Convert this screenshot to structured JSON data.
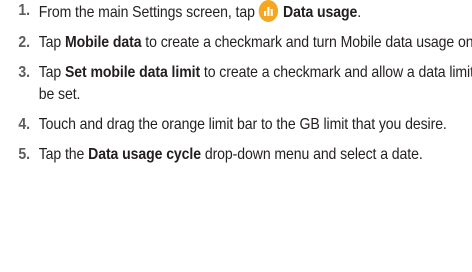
{
  "steps": [
    {
      "number": "1.",
      "pre": "From the main Settings screen, tap",
      "bold": "Data usage",
      "post": ".",
      "icon": "data-usage-icon",
      "icon_color": "#f5a623"
    },
    {
      "number": "2.",
      "pre": "Tap ",
      "bold": "Mobile data",
      "post": " to create a checkmark and turn Mobile data usage on."
    },
    {
      "number": "3.",
      "pre": "Tap ",
      "bold": "Set mobile data limit",
      "post": " to create a checkmark and allow a data limit to be set."
    },
    {
      "number": "4.",
      "text": "Touch and drag the orange limit bar to the GB limit that you desire."
    },
    {
      "number": "5.",
      "pre": "Tap the ",
      "bold": "Data usage cycle",
      "post": " drop-down menu and select a date."
    }
  ]
}
